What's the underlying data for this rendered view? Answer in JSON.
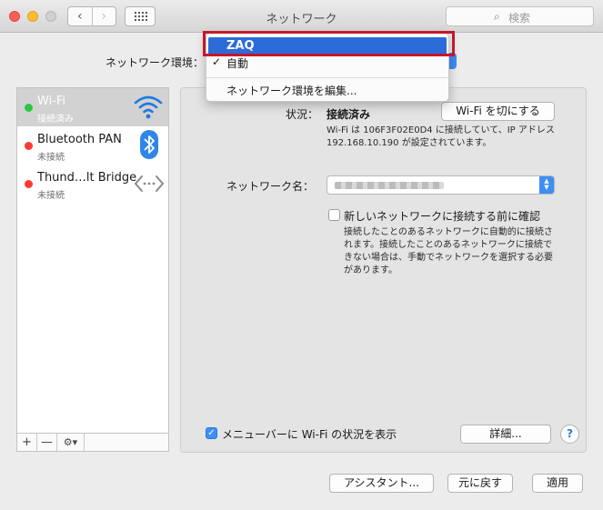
{
  "window": {
    "title": "ネットワーク",
    "search_placeholder": "検索"
  },
  "location": {
    "label": "ネットワーク環境：",
    "menu": {
      "selected": "ZAQ",
      "checkmark": "✓",
      "current": "自動",
      "edit": "ネットワーク環境を編集..."
    }
  },
  "sidebar": {
    "services": [
      {
        "name": "Wi-Fi",
        "status": "接続済み",
        "dot_color": "#28c840",
        "selected": true,
        "icon": "wifi-icon"
      },
      {
        "name": "Bluetooth PAN",
        "status": "未接続",
        "dot_color": "#ff3b30",
        "selected": false,
        "icon": "bluetooth-icon"
      },
      {
        "name": "Thund…lt Bridge",
        "status": "未接続",
        "dot_color": "#ff3b30",
        "selected": false,
        "icon": "thunderbolt-bridge-icon"
      }
    ],
    "tools": {
      "add": "+",
      "remove": "—",
      "gear": "⚙▾"
    }
  },
  "detail": {
    "status_label": "状況：",
    "status_value": "接続済み",
    "wifi_off_button": "Wi-Fi を切にする",
    "status_description": "Wi-Fi は 106F3F02E0D4 に接続していて、IP アドレス 192.168.10.190 が設定されています。",
    "network_name_label": "ネットワーク名：",
    "ask_to_join_label": "新しいネットワークに接続する前に確認",
    "ask_to_join_checked": false,
    "ask_to_join_description": "接続したことのあるネットワークに自動的に接続されます。接続したことのあるネットワークに接続できない場合は、手動でネットワークを選択する必要があります。",
    "menubar_label": "メニューバーに Wi-Fi の状況を表示",
    "menubar_checked": true,
    "advanced_button": "詳細...",
    "help_button": "?"
  },
  "footer": {
    "assistant_button": "アシスタント...",
    "revert_button": "元に戻す",
    "apply_button": "適用"
  },
  "colors": {
    "accent": "#3d8ef5",
    "highlight": "#c7162b",
    "connected": "#28c840",
    "disconnected": "#ff3b30"
  }
}
